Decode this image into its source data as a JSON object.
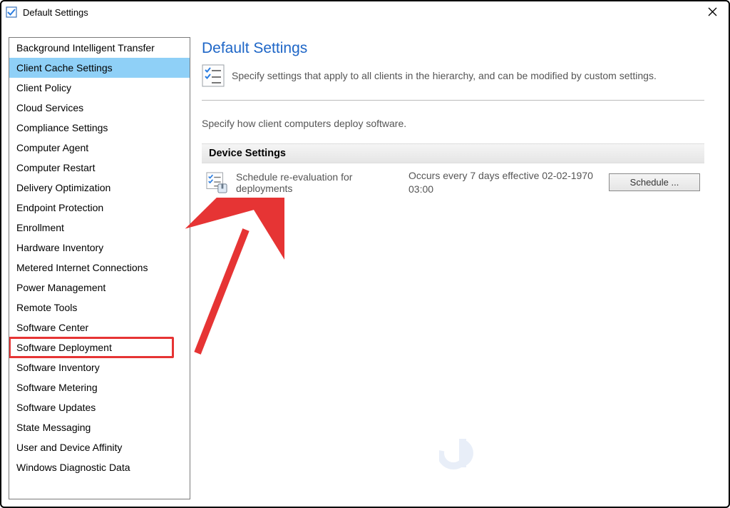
{
  "window": {
    "title": "Default Settings"
  },
  "sidebar": {
    "items": [
      {
        "label": "Background Intelligent Transfer"
      },
      {
        "label": "Client Cache Settings"
      },
      {
        "label": "Client Policy"
      },
      {
        "label": "Cloud Services"
      },
      {
        "label": "Compliance Settings"
      },
      {
        "label": "Computer Agent"
      },
      {
        "label": "Computer Restart"
      },
      {
        "label": "Delivery Optimization"
      },
      {
        "label": "Endpoint Protection"
      },
      {
        "label": "Enrollment"
      },
      {
        "label": "Hardware Inventory"
      },
      {
        "label": "Metered Internet Connections"
      },
      {
        "label": "Power Management"
      },
      {
        "label": "Remote Tools"
      },
      {
        "label": "Software Center"
      },
      {
        "label": "Software Deployment"
      },
      {
        "label": "Software Inventory"
      },
      {
        "label": "Software Metering"
      },
      {
        "label": "Software Updates"
      },
      {
        "label": "State Messaging"
      },
      {
        "label": "User and Device Affinity"
      },
      {
        "label": "Windows Diagnostic Data"
      }
    ]
  },
  "content": {
    "title": "Default Settings",
    "intro": "Specify settings that apply to all clients in the hierarchy, and can be modified by custom settings.",
    "subtext": "Specify how client computers deploy software.",
    "section_header": "Device Settings",
    "setting": {
      "name": "Schedule re-evaluation for deployments",
      "value": "Occurs every 7 days effective 02-02-1970 03:00",
      "button_label": "Schedule ..."
    }
  }
}
